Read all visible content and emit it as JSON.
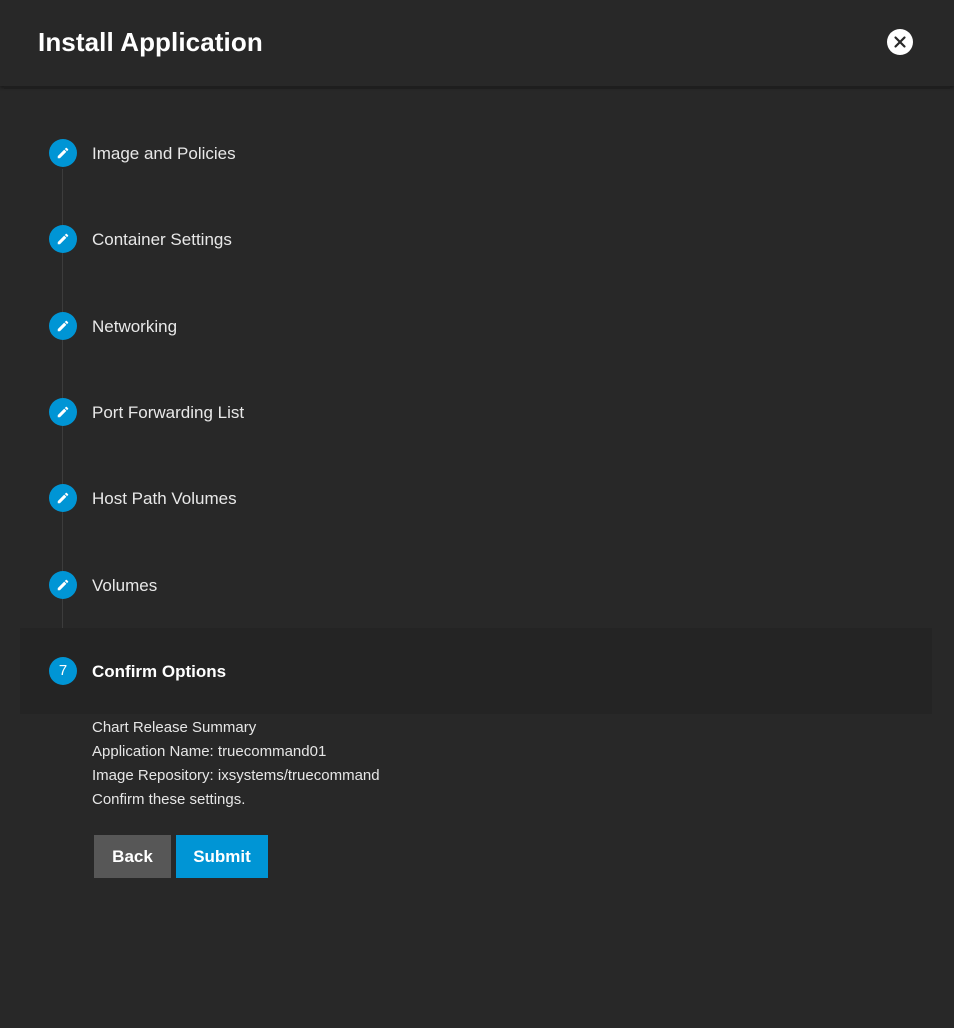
{
  "dialog": {
    "title": "Install Application",
    "close_icon": "close-icon"
  },
  "colors": {
    "background": "#282828",
    "accent": "#0095d5",
    "back_button": "#575757"
  },
  "steps": [
    {
      "label": "Image and Policies",
      "state": "edit",
      "icon": "pencil-icon"
    },
    {
      "label": "Container Settings",
      "state": "edit",
      "icon": "pencil-icon"
    },
    {
      "label": "Networking",
      "state": "edit",
      "icon": "pencil-icon"
    },
    {
      "label": "Port Forwarding List",
      "state": "edit",
      "icon": "pencil-icon"
    },
    {
      "label": "Host Path Volumes",
      "state": "edit",
      "icon": "pencil-icon"
    },
    {
      "label": "Volumes",
      "state": "edit",
      "icon": "pencil-icon"
    },
    {
      "label": "Confirm Options",
      "state": "active",
      "number": "7"
    }
  ],
  "summary": {
    "heading": "Chart Release Summary",
    "app_name": "Application Name: truecommand01",
    "image_repo": "Image Repository: ixsystems/truecommand",
    "confirm_text": "Confirm these settings."
  },
  "actions": {
    "back_label": "Back",
    "submit_label": "Submit"
  }
}
